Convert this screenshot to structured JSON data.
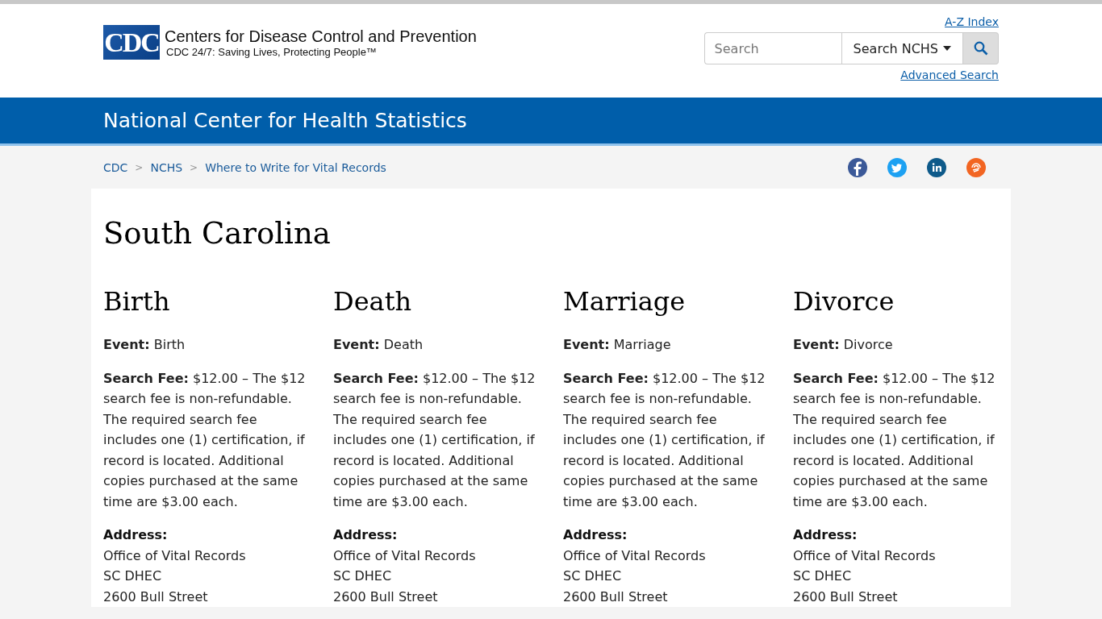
{
  "header": {
    "logo_text": "CDC",
    "org_name": "Centers for Disease Control and Prevention",
    "tagline": "CDC 24/7: Saving Lives, Protecting People™",
    "az_link": "A-Z Index",
    "search": {
      "placeholder": "Search"
    },
    "search_scope": "Search NCHS",
    "advanced_link": "Advanced Search"
  },
  "banner": {
    "title": "National Center for Health Statistics"
  },
  "breadcrumbs": [
    {
      "label": "CDC"
    },
    {
      "label": "NCHS"
    },
    {
      "label": "Where to Write for Vital Records"
    }
  ],
  "breadcrumb_separator": ">",
  "social": [
    {
      "kind": "facebook",
      "color": "#3b5998"
    },
    {
      "kind": "twitter",
      "color": "#1da1f2"
    },
    {
      "kind": "linkedin",
      "color": "#0e5a8a"
    },
    {
      "kind": "syndicate",
      "color": "#f26522"
    }
  ],
  "page_title": "South Carolina",
  "columns": [
    {
      "heading": "Birth",
      "event": "**Event:** Birth",
      "fee": "**Search Fee:** $12.00 – The $12 search fee is non-refundable. The required search fee includes one (1) certification, if record is located. Additional copies purchased at the same time are $3.00 each.",
      "address_label": "Address:",
      "address_lines": [
        "Office of Vital Records",
        "SC DHEC",
        "2600 Bull Street"
      ]
    },
    {
      "heading": "Death",
      "event": "**Event:** Death",
      "fee": "**Search Fee:** $12.00 – The $12 search fee is non-refundable. The required search fee includes one (1) certification, if record is located. Additional copies purchased at the same time are $3.00 each.",
      "address_label": "Address:",
      "address_lines": [
        "Office of Vital Records",
        "SC DHEC",
        "2600 Bull Street"
      ]
    },
    {
      "heading": "Marriage",
      "event": "**Event:** Marriage",
      "fee": "**Search Fee:** $12.00 – The $12 search fee is non-refundable. The required search fee includes one (1) certification, if record is located. Additional copies purchased at the same time are $3.00 each.",
      "address_label": "Address:",
      "address_lines": [
        "Office of Vital Records",
        "SC DHEC",
        "2600 Bull Street"
      ]
    },
    {
      "heading": "Divorce",
      "event": "**Event:** Divorce",
      "fee": "**Search Fee:** $12.00 – The $12 search fee is non-refundable. The required search fee includes one (1) certification, if record is located. Additional copies purchased at the same time are $3.00 each.",
      "address_label": "Address:",
      "address_lines": [
        "Office of Vital Records",
        "SC DHEC",
        "2600 Bull Street"
      ]
    }
  ]
}
